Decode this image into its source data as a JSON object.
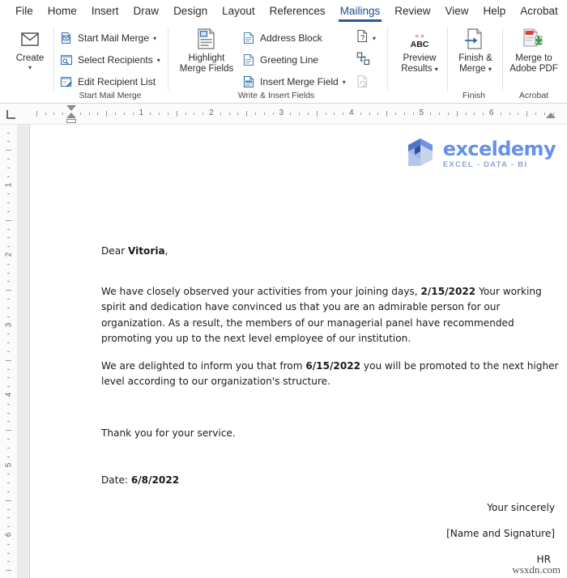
{
  "app": {
    "name": "Microsoft Word",
    "accent_color": "#2b579a"
  },
  "tabs": [
    {
      "id": "file",
      "label": "File",
      "active": false
    },
    {
      "id": "home",
      "label": "Home",
      "active": false
    },
    {
      "id": "insert",
      "label": "Insert",
      "active": false
    },
    {
      "id": "draw",
      "label": "Draw",
      "active": false
    },
    {
      "id": "design",
      "label": "Design",
      "active": false
    },
    {
      "id": "layout",
      "label": "Layout",
      "active": false
    },
    {
      "id": "references",
      "label": "References",
      "active": false
    },
    {
      "id": "mailings",
      "label": "Mailings",
      "active": true
    },
    {
      "id": "review",
      "label": "Review",
      "active": false
    },
    {
      "id": "view",
      "label": "View",
      "active": false
    },
    {
      "id": "help",
      "label": "Help",
      "active": false
    },
    {
      "id": "acrobat",
      "label": "Acrobat",
      "active": false
    }
  ],
  "ribbon": {
    "groups": [
      {
        "id": "create",
        "label": "",
        "big_buttons": [
          {
            "id": "create",
            "label": "Create",
            "icon": "envelope-icon",
            "has_caret": true
          }
        ]
      },
      {
        "id": "start-mail-merge",
        "label": "Start Mail Merge",
        "items": [
          {
            "id": "start-mail-merge",
            "label": "Start Mail Merge",
            "icon": "mail-merge-doc-icon",
            "has_caret": true
          },
          {
            "id": "select-recipients",
            "label": "Select Recipients",
            "icon": "select-recipients-icon",
            "has_caret": true
          },
          {
            "id": "edit-recipient-list",
            "label": "Edit Recipient List",
            "icon": "edit-recipient-icon",
            "has_caret": false
          }
        ]
      },
      {
        "id": "write-insert-fields",
        "label": "Write & Insert Fields",
        "big_buttons": [
          {
            "id": "highlight-merge-fields",
            "label": "Highlight\nMerge Fields",
            "icon": "highlight-fields-icon",
            "has_caret": false
          }
        ],
        "items": [
          {
            "id": "address-block",
            "label": "Address Block",
            "icon": "address-block-icon",
            "has_caret": false
          },
          {
            "id": "greeting-line",
            "label": "Greeting Line",
            "icon": "greeting-line-icon",
            "has_caret": false
          },
          {
            "id": "insert-merge-field",
            "label": "Insert Merge Field",
            "icon": "insert-merge-field-icon",
            "has_caret": true
          }
        ],
        "icon_items": [
          {
            "id": "rules",
            "icon": "rules-icon",
            "has_caret": true,
            "disabled": false
          },
          {
            "id": "match-fields",
            "icon": "match-fields-icon",
            "has_caret": false,
            "disabled": false
          },
          {
            "id": "update-labels",
            "icon": "update-labels-icon",
            "has_caret": false,
            "disabled": true
          }
        ]
      },
      {
        "id": "preview-results",
        "label": "",
        "big_buttons": [
          {
            "id": "preview-results",
            "label": "Preview\nResults",
            "icon": "abc-preview-icon",
            "has_caret": true
          }
        ]
      },
      {
        "id": "finish",
        "label": "Finish",
        "big_buttons": [
          {
            "id": "finish-and-merge",
            "label": "Finish &\nMerge",
            "icon": "finish-merge-icon",
            "has_caret": true
          }
        ]
      },
      {
        "id": "acrobat",
        "label": "Acrobat",
        "big_buttons": [
          {
            "id": "merge-to-adobe-pdf",
            "label": "Merge to\nAdobe PDF",
            "icon": "merge-adobe-pdf-icon",
            "has_caret": false
          }
        ]
      }
    ],
    "labels": {
      "create": "Create",
      "start_mail_merge_btn": "Start Mail Merge",
      "select_recipients": "Select Recipients",
      "edit_recipient_list": "Edit Recipient List",
      "group_start_mail_merge": "Start Mail Merge",
      "highlight_merge_fields_l1": "Highlight",
      "highlight_merge_fields_l2": "Merge Fields",
      "address_block": "Address Block",
      "greeting_line": "Greeting Line",
      "insert_merge_field": "Insert Merge Field",
      "group_write_insert": "Write & Insert Fields",
      "preview_results_l1": "Preview",
      "preview_results_l2": "Results",
      "finish_merge_l1": "Finish &",
      "finish_merge_l2": "Merge",
      "group_finish": "Finish",
      "merge_adobe_l1": "Merge to",
      "merge_adobe_l2": "Adobe PDF",
      "group_acrobat": "Acrobat",
      "abc_text": "ABC"
    }
  },
  "ruler": {
    "horizontal_numbers": [
      "1",
      "2",
      "3",
      "4",
      "5",
      "6"
    ],
    "vertical_numbers": [
      "1",
      "2",
      "3",
      "4",
      "5",
      "6"
    ],
    "units": "inches"
  },
  "document": {
    "logo": {
      "name": "exceldemy",
      "subtitle": "EXCEL - DATA - BI"
    },
    "salutation_prefix": "Dear ",
    "salutation_name": "Vitoria",
    "salutation_suffix": ",",
    "paragraph1_a": "We have closely observed your activities from your joining days, ",
    "paragraph1_date": "2/15/2022",
    "paragraph1_b": " Your working spirit and dedication have convinced us that you are an admirable person for our organization. As a result, the members of our managerial panel have recommended promoting you up to the next level employee of our institution.",
    "paragraph2_a": "We are delighted to inform you that from ",
    "paragraph2_date": "6/15/2022",
    "paragraph2_b": " you will be promoted to the next higher level according to our organization's structure.",
    "thanks": "Thank you for your service.",
    "date_label": "Date: ",
    "date_value": "6/8/2022",
    "sincerely": "Your sincerely",
    "signature": "[Name and Signature]",
    "hr": "HR"
  },
  "watermark": "wsxdn.com"
}
